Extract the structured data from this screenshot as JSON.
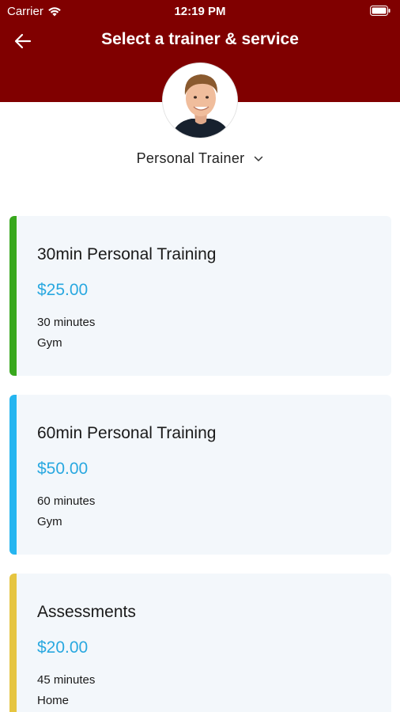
{
  "status_bar": {
    "carrier": "Carrier",
    "time": "12:19 PM"
  },
  "header": {
    "title": "Select a trainer & service",
    "back_icon": "arrow-left-icon"
  },
  "colors": {
    "header_bg": "#800000",
    "price": "#29a8e0",
    "card_bg": "#f3f7fb",
    "accent_green": "#38a81d",
    "accent_blue": "#25b5f0",
    "accent_yellow": "#e6c540"
  },
  "trainer": {
    "selected": "Personal Trainer"
  },
  "services": [
    {
      "title": "30min Personal Training",
      "price": "$25.00",
      "duration": "30 minutes",
      "location": "Gym"
    },
    {
      "title": "60min Personal Training",
      "price": "$50.00",
      "duration": "60 minutes",
      "location": "Gym"
    },
    {
      "title": "Assessments",
      "price": "$20.00",
      "duration": "45 minutes",
      "location": "Home"
    }
  ]
}
